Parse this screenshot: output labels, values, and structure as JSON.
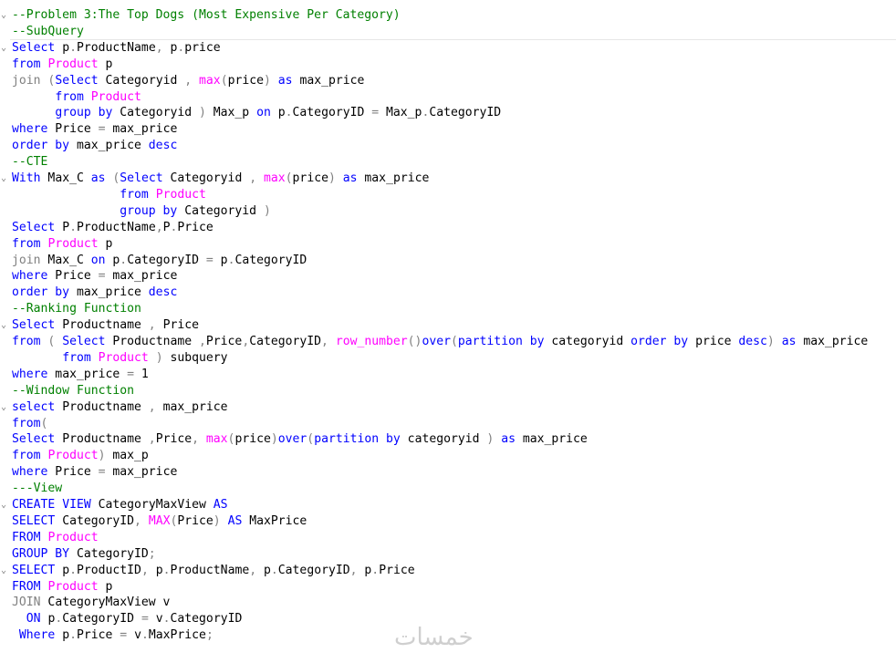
{
  "colors": {
    "keyword": "#0000ff",
    "function": "#ff00ff",
    "comment": "#008000",
    "operator": "#808080",
    "text": "#000000"
  },
  "watermark": "خمسات",
  "code_lines": [
    [
      [
        "--Problem 3:The Top Dogs (Most Expensive Per Category)",
        "c"
      ]
    ],
    [
      [
        "--SubQuery",
        "c"
      ]
    ],
    [
      [
        "Select",
        "k"
      ],
      [
        " p",
        "t"
      ],
      [
        ".",
        "o"
      ],
      [
        "ProductName",
        "t"
      ],
      [
        ",",
        "o"
      ],
      [
        " p",
        "t"
      ],
      [
        ".",
        "o"
      ],
      [
        "price",
        "t"
      ]
    ],
    [
      [
        "from",
        "k"
      ],
      [
        " ",
        "t"
      ],
      [
        "Product",
        "f"
      ],
      [
        " p",
        "t"
      ]
    ],
    [
      [
        "join",
        "o"
      ],
      [
        " (",
        "o"
      ],
      [
        "Select",
        "k"
      ],
      [
        " Categoryid ",
        "t"
      ],
      [
        ",",
        "o"
      ],
      [
        " ",
        "t"
      ],
      [
        "max",
        "f"
      ],
      [
        "(",
        "o"
      ],
      [
        "price",
        "t"
      ],
      [
        ")",
        "o"
      ],
      [
        " ",
        "t"
      ],
      [
        "as",
        "k"
      ],
      [
        " max_price",
        "t"
      ]
    ],
    [
      [
        "      ",
        "t"
      ],
      [
        "from",
        "k"
      ],
      [
        " ",
        "t"
      ],
      [
        "Product",
        "f"
      ]
    ],
    [
      [
        "      ",
        "t"
      ],
      [
        "group by",
        "k"
      ],
      [
        " Categoryid ",
        "t"
      ],
      [
        ")",
        "o"
      ],
      [
        " Max_p ",
        "t"
      ],
      [
        "on",
        "k"
      ],
      [
        " p",
        "t"
      ],
      [
        ".",
        "o"
      ],
      [
        "CategoryID ",
        "t"
      ],
      [
        "=",
        "o"
      ],
      [
        " Max_p",
        "t"
      ],
      [
        ".",
        "o"
      ],
      [
        "CategoryID",
        "t"
      ]
    ],
    [
      [
        "where",
        "k"
      ],
      [
        " Price ",
        "t"
      ],
      [
        "=",
        "o"
      ],
      [
        " max_price",
        "t"
      ]
    ],
    [
      [
        "order by",
        "k"
      ],
      [
        " max_price ",
        "t"
      ],
      [
        "desc",
        "k"
      ]
    ],
    [
      [
        "--CTE",
        "c"
      ]
    ],
    [
      [
        "With",
        "k"
      ],
      [
        " Max_C ",
        "t"
      ],
      [
        "as",
        "k"
      ],
      [
        " (",
        "o"
      ],
      [
        "Select",
        "k"
      ],
      [
        " Categoryid ",
        "t"
      ],
      [
        ",",
        "o"
      ],
      [
        " ",
        "t"
      ],
      [
        "max",
        "f"
      ],
      [
        "(",
        "o"
      ],
      [
        "price",
        "t"
      ],
      [
        ")",
        "o"
      ],
      [
        " ",
        "t"
      ],
      [
        "as",
        "k"
      ],
      [
        " max_price",
        "t"
      ]
    ],
    [
      [
        "               ",
        "t"
      ],
      [
        "from",
        "k"
      ],
      [
        " ",
        "t"
      ],
      [
        "Product",
        "f"
      ]
    ],
    [
      [
        "               ",
        "t"
      ],
      [
        "group by",
        "k"
      ],
      [
        " Categoryid ",
        "t"
      ],
      [
        ")",
        "o"
      ]
    ],
    [
      [
        "Select",
        "k"
      ],
      [
        " P",
        "t"
      ],
      [
        ".",
        "o"
      ],
      [
        "ProductName",
        "t"
      ],
      [
        ",",
        "o"
      ],
      [
        "P",
        "t"
      ],
      [
        ".",
        "o"
      ],
      [
        "Price",
        "t"
      ]
    ],
    [
      [
        "from",
        "k"
      ],
      [
        " ",
        "t"
      ],
      [
        "Product",
        "f"
      ],
      [
        " p",
        "t"
      ]
    ],
    [
      [
        "join",
        "o"
      ],
      [
        " Max_C ",
        "t"
      ],
      [
        "on",
        "k"
      ],
      [
        " p",
        "t"
      ],
      [
        ".",
        "o"
      ],
      [
        "CategoryID ",
        "t"
      ],
      [
        "=",
        "o"
      ],
      [
        " p",
        "t"
      ],
      [
        ".",
        "o"
      ],
      [
        "CategoryID",
        "t"
      ]
    ],
    [
      [
        "where",
        "k"
      ],
      [
        " Price ",
        "t"
      ],
      [
        "=",
        "o"
      ],
      [
        " max_price",
        "t"
      ]
    ],
    [
      [
        "order by",
        "k"
      ],
      [
        " max_price ",
        "t"
      ],
      [
        "desc",
        "k"
      ]
    ],
    [
      [
        "--Ranking Function",
        "c"
      ]
    ],
    [
      [
        "Select",
        "k"
      ],
      [
        " Productname ",
        "t"
      ],
      [
        ",",
        "o"
      ],
      [
        " Price",
        "t"
      ]
    ],
    [
      [
        "from",
        "k"
      ],
      [
        " ( ",
        "o"
      ],
      [
        "Select",
        "k"
      ],
      [
        " Productname ",
        "t"
      ],
      [
        ",",
        "o"
      ],
      [
        "Price",
        "t"
      ],
      [
        ",",
        "o"
      ],
      [
        "CategoryID",
        "t"
      ],
      [
        ",",
        "o"
      ],
      [
        " ",
        "t"
      ],
      [
        "row_number",
        "f"
      ],
      [
        "()",
        "o"
      ],
      [
        "over",
        "k"
      ],
      [
        "(",
        "o"
      ],
      [
        "partition by",
        "k"
      ],
      [
        " categoryid ",
        "t"
      ],
      [
        "order by",
        "k"
      ],
      [
        " price ",
        "t"
      ],
      [
        "desc",
        "k"
      ],
      [
        ")",
        "o"
      ],
      [
        " ",
        "t"
      ],
      [
        "as",
        "k"
      ],
      [
        " max_price",
        "t"
      ]
    ],
    [
      [
        "       ",
        "t"
      ],
      [
        "from",
        "k"
      ],
      [
        " ",
        "t"
      ],
      [
        "Product",
        "f"
      ],
      [
        " ",
        "t"
      ],
      [
        ")",
        "o"
      ],
      [
        " subquery",
        "t"
      ]
    ],
    [
      [
        "where",
        "k"
      ],
      [
        " max_price ",
        "t"
      ],
      [
        "=",
        "o"
      ],
      [
        " 1",
        "t"
      ]
    ],
    [
      [
        "--Window Function",
        "c"
      ]
    ],
    [
      [
        "select",
        "k"
      ],
      [
        " Productname ",
        "t"
      ],
      [
        ",",
        "o"
      ],
      [
        " max_price",
        "t"
      ]
    ],
    [
      [
        "from",
        "k"
      ],
      [
        "(",
        "o"
      ]
    ],
    [
      [
        "Select",
        "k"
      ],
      [
        " Productname ",
        "t"
      ],
      [
        ",",
        "o"
      ],
      [
        "Price",
        "t"
      ],
      [
        ",",
        "o"
      ],
      [
        " ",
        "t"
      ],
      [
        "max",
        "f"
      ],
      [
        "(",
        "o"
      ],
      [
        "price",
        "t"
      ],
      [
        ")",
        "o"
      ],
      [
        "over",
        "k"
      ],
      [
        "(",
        "o"
      ],
      [
        "partition by",
        "k"
      ],
      [
        " categoryid ",
        "t"
      ],
      [
        ")",
        "o"
      ],
      [
        " ",
        "t"
      ],
      [
        "as",
        "k"
      ],
      [
        " max_price",
        "t"
      ]
    ],
    [
      [
        "from",
        "k"
      ],
      [
        " ",
        "t"
      ],
      [
        "Product",
        "f"
      ],
      [
        ")",
        "o"
      ],
      [
        " max_p",
        "t"
      ]
    ],
    [
      [
        "where",
        "k"
      ],
      [
        " Price ",
        "t"
      ],
      [
        "=",
        "o"
      ],
      [
        " max_price",
        "t"
      ]
    ],
    [
      [
        "---View",
        "c"
      ]
    ],
    [
      [
        "CREATE",
        "k"
      ],
      [
        " ",
        "t"
      ],
      [
        "VIEW",
        "k"
      ],
      [
        " CategoryMaxView ",
        "t"
      ],
      [
        "AS",
        "k"
      ]
    ],
    [
      [
        "SELECT",
        "k"
      ],
      [
        " CategoryID",
        "t"
      ],
      [
        ",",
        "o"
      ],
      [
        " ",
        "t"
      ],
      [
        "MAX",
        "f"
      ],
      [
        "(",
        "o"
      ],
      [
        "Price",
        "t"
      ],
      [
        ")",
        "o"
      ],
      [
        " ",
        "t"
      ],
      [
        "AS",
        "k"
      ],
      [
        " MaxPrice",
        "t"
      ]
    ],
    [
      [
        "FROM",
        "k"
      ],
      [
        " ",
        "t"
      ],
      [
        "Product",
        "f"
      ]
    ],
    [
      [
        "GROUP BY",
        "k"
      ],
      [
        " CategoryID",
        "t"
      ],
      [
        ";",
        "o"
      ]
    ],
    [
      [
        "SELECT",
        "k"
      ],
      [
        " p",
        "t"
      ],
      [
        ".",
        "o"
      ],
      [
        "ProductID",
        "t"
      ],
      [
        ",",
        "o"
      ],
      [
        " p",
        "t"
      ],
      [
        ".",
        "o"
      ],
      [
        "ProductName",
        "t"
      ],
      [
        ",",
        "o"
      ],
      [
        " p",
        "t"
      ],
      [
        ".",
        "o"
      ],
      [
        "CategoryID",
        "t"
      ],
      [
        ",",
        "o"
      ],
      [
        " p",
        "t"
      ],
      [
        ".",
        "o"
      ],
      [
        "Price",
        "t"
      ]
    ],
    [
      [
        "FROM",
        "k"
      ],
      [
        " ",
        "t"
      ],
      [
        "Product",
        "f"
      ],
      [
        " p",
        "t"
      ]
    ],
    [
      [
        "JOIN",
        "o"
      ],
      [
        " CategoryMaxView v",
        "t"
      ]
    ],
    [
      [
        "  ",
        "t"
      ],
      [
        "ON",
        "k"
      ],
      [
        " p",
        "t"
      ],
      [
        ".",
        "o"
      ],
      [
        "CategoryID ",
        "t"
      ],
      [
        "=",
        "o"
      ],
      [
        " v",
        "t"
      ],
      [
        ".",
        "o"
      ],
      [
        "CategoryID",
        "t"
      ]
    ],
    [
      [
        " ",
        "t"
      ],
      [
        "Where",
        "k"
      ],
      [
        " p",
        "t"
      ],
      [
        ".",
        "o"
      ],
      [
        "Price ",
        "t"
      ],
      [
        "=",
        "o"
      ],
      [
        " v",
        "t"
      ],
      [
        ".",
        "o"
      ],
      [
        "MaxPrice",
        "t"
      ],
      [
        ";",
        "o"
      ]
    ]
  ],
  "fold_markers": [
    0,
    2,
    10,
    19,
    24,
    30,
    34
  ]
}
